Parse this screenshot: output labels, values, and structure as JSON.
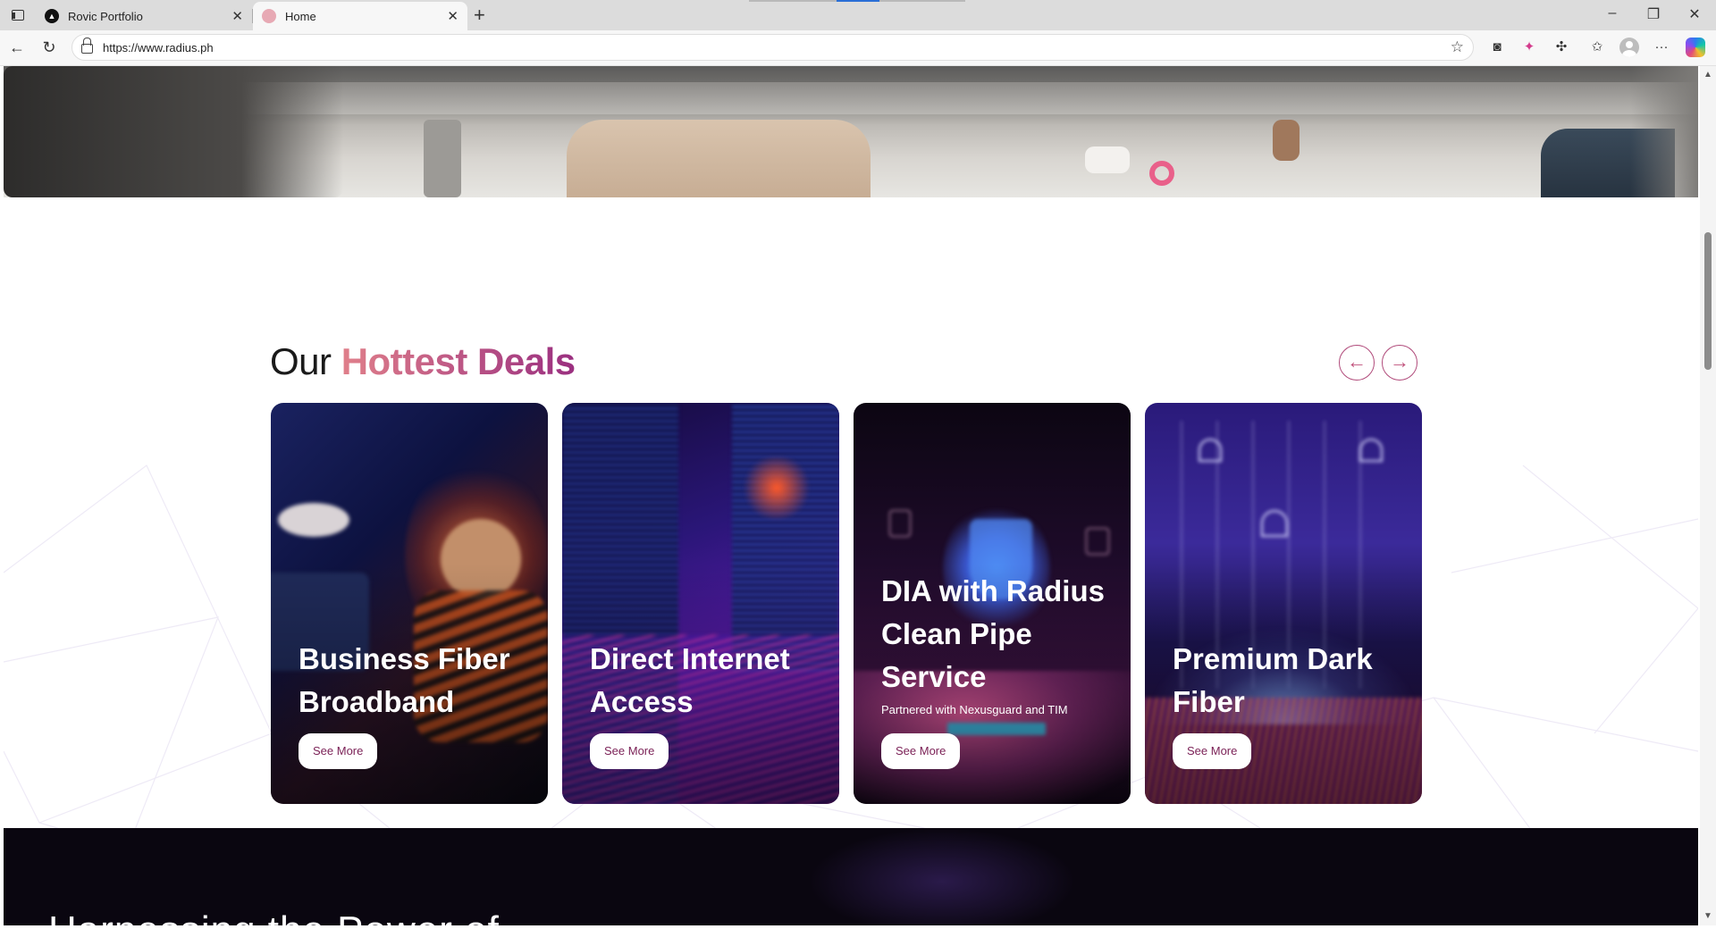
{
  "browser": {
    "tabs": [
      {
        "title": "Rovic Portfolio",
        "favicon": "rovic-logo-icon",
        "active": false
      },
      {
        "title": "Home",
        "favicon": "radius-logo-icon",
        "active": true
      }
    ],
    "url": "https://www.radius.ph",
    "window_controls": {
      "minimize": "–",
      "restore": "❐",
      "close": "✕"
    }
  },
  "deals": {
    "title_plain": "Our ",
    "title_highlight": "Hottest Deals",
    "prev_arrow": "←",
    "next_arrow": "→",
    "cards": [
      {
        "title": "Business Fiber Broadband",
        "subtitle": "",
        "button": "See More"
      },
      {
        "title": "Direct Internet Access",
        "subtitle": "",
        "button": "See More"
      },
      {
        "title": "DIA with Radius Clean Pipe Service",
        "subtitle": "Partnered with Nexusguard and TIM",
        "button": "See More"
      },
      {
        "title": "Premium Dark Fiber",
        "subtitle": "",
        "button": "See More"
      }
    ]
  },
  "next_section": {
    "heading": "Harnessing the Power of"
  },
  "colors": {
    "accent_start": "#e07f8a",
    "accent_end": "#9a2f80",
    "button_text": "#7a1f55",
    "dark_section": "#0a0610"
  }
}
